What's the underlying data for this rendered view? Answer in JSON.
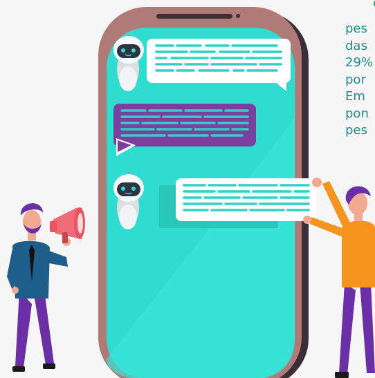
{
  "side_text": {
    "top_fragment": "c",
    "lines": [
      "pes",
      "das",
      "29%",
      "por",
      "Em",
      "pon",
      "pes"
    ]
  },
  "colors": {
    "phone_frame": "#b07a76",
    "phone_shadow": "#3b2e36",
    "screen": "#2fddd0",
    "bubble_white": "#ffffff",
    "bubble_purple": "#7b3f9e",
    "text_lines": "#2fd1c8",
    "text_teal": "#1f8c8c"
  },
  "icons": {
    "bot_1": "robot-icon",
    "bot_2": "robot-icon",
    "megaphone": "megaphone-icon"
  }
}
